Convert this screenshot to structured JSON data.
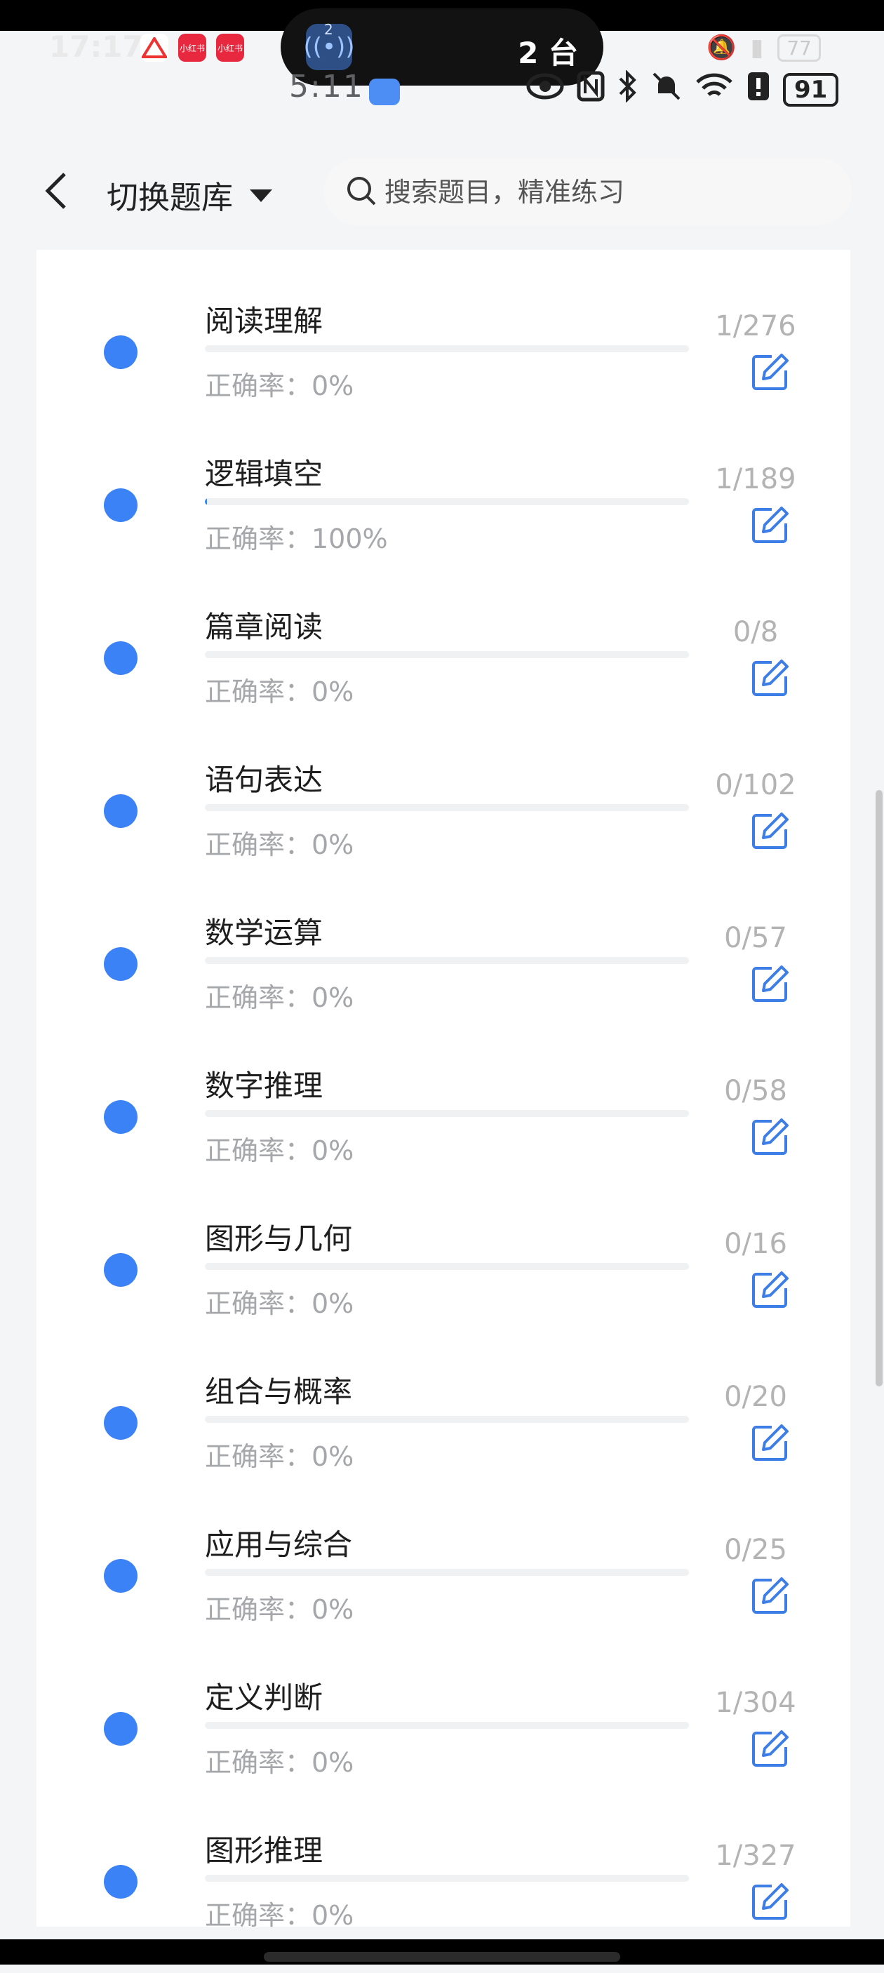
{
  "status_bar": {
    "time": "5:11",
    "battery": "91",
    "island_badge": "2",
    "island_text": "2 台",
    "bg_time": "17:17",
    "bg_battery": "77",
    "bg_app_labels": [
      "小红书",
      "小红书"
    ]
  },
  "header": {
    "switch_label": "切换题库",
    "search_placeholder": "搜索题目，精准练习"
  },
  "accuracy_prefix": "正确率：",
  "items": [
    {
      "title": "阅读理解",
      "accuracy": "正确率：0%",
      "count": "1/276",
      "progress": 0
    },
    {
      "title": "逻辑填空",
      "accuracy": "正确率：100%",
      "count": "1/189",
      "progress": 0.005
    },
    {
      "title": "篇章阅读",
      "accuracy": "正确率：0%",
      "count": "0/8",
      "progress": 0
    },
    {
      "title": "语句表达",
      "accuracy": "正确率：0%",
      "count": "0/102",
      "progress": 0
    },
    {
      "title": "数学运算",
      "accuracy": "正确率：0%",
      "count": "0/57",
      "progress": 0
    },
    {
      "title": "数字推理",
      "accuracy": "正确率：0%",
      "count": "0/58",
      "progress": 0
    },
    {
      "title": "图形与几何",
      "accuracy": "正确率：0%",
      "count": "0/16",
      "progress": 0
    },
    {
      "title": "组合与概率",
      "accuracy": "正确率：0%",
      "count": "0/20",
      "progress": 0
    },
    {
      "title": "应用与综合",
      "accuracy": "正确率：0%",
      "count": "0/25",
      "progress": 0
    },
    {
      "title": "定义判断",
      "accuracy": "正确率：0%",
      "count": "1/304",
      "progress": 0
    },
    {
      "title": "图形推理",
      "accuracy": "正确率：0%",
      "count": "1/327",
      "progress": 0
    }
  ],
  "colors": {
    "accent": "#3b82f6",
    "edit_icon": "#3d7ee6"
  }
}
